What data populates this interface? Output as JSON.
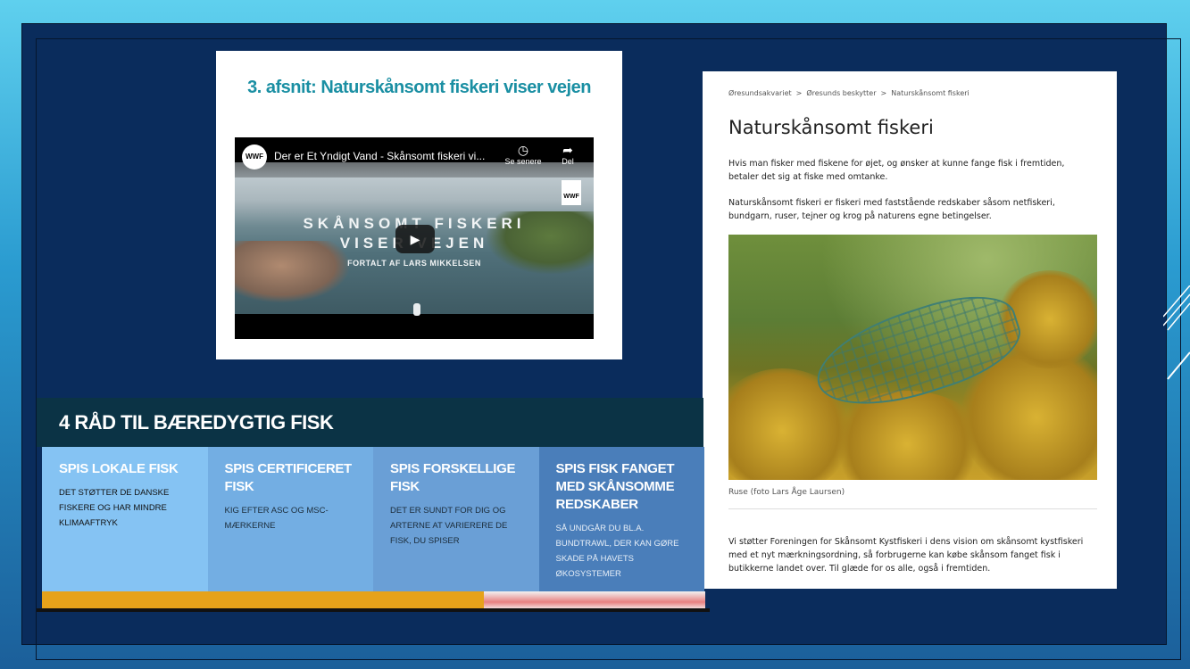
{
  "video_panel": {
    "heading": "3. afsnit: Naturskånsomt fiskeri viser vejen",
    "video": {
      "logo": "WWF",
      "title": "Der er Et Yndigt Vand - Skånsomt fiskeri vi...",
      "watch_later_label": "Se senere",
      "share_label": "Del",
      "overlay_title_line1": "SKÅNSOMT FISKERI",
      "overlay_title_line2": "VISER VEJEN",
      "overlay_subtitle": "FORTALT AF LARS MIKKELSEN",
      "badge": "WWF",
      "play_icon": "play-icon"
    }
  },
  "article": {
    "breadcrumb": [
      "Øresundsakvariet",
      "Øresunds beskytter",
      "Naturskånsomt fiskeri"
    ],
    "breadcrumb_sep": ">",
    "title": "Naturskånsomt fiskeri",
    "paragraph1": "Hvis man fisker med fiskene for øjet, og ønsker at kunne fange fisk i fremtiden, betaler det sig at fiske med omtanke.",
    "paragraph2": "Naturskånsomt fiskeri er fiskeri med faststående redskaber såsom netfiskeri, bundgarn, ruser, tejner og krog på naturens egne betingelser.",
    "image_caption": "Ruse (foto Lars Åge Laursen)",
    "paragraph3": "Vi støtter Foreningen for Skånsomt Kystfiskeri i dens vision om skånsomt kystfiskeri med et nyt mærkningsordning, så forbrugerne kan købe skånsom fanget fisk i butikkerne landet over. Til glæde for os alle, også i fremtiden."
  },
  "advice": {
    "title": "4 RÅD TIL BÆREDYGTIG FISK",
    "cards": [
      {
        "heading": "SPIS LOKALE FISK",
        "body": "DET STØTTER DE DANSKE FISKERE OG HAR MINDRE KLIMAAFTRYK"
      },
      {
        "heading": "SPIS CERTIFICERET FISK",
        "body": "KIG EFTER ASC OG MSC-MÆRKERNE"
      },
      {
        "heading": "SPIS FORSKELLIGE FISK",
        "body": "DET ER SUNDT FOR DIG OG ARTERNE AT VARIERERE DE FISK, DU SPISER"
      },
      {
        "heading": "SPIS FISK FANGET MED SKÅNSOMME REDSKABER",
        "body": "SÅ UNDGÅR DU BL.A. BUNDTRAWL, DER KAN GØRE SKADE PÅ HAVETS ØKOSYSTEMER"
      }
    ]
  },
  "colors": {
    "slide_background": "#0a2c5c",
    "heading_teal": "#1a8fa3",
    "advice_header": "#0b3345"
  }
}
